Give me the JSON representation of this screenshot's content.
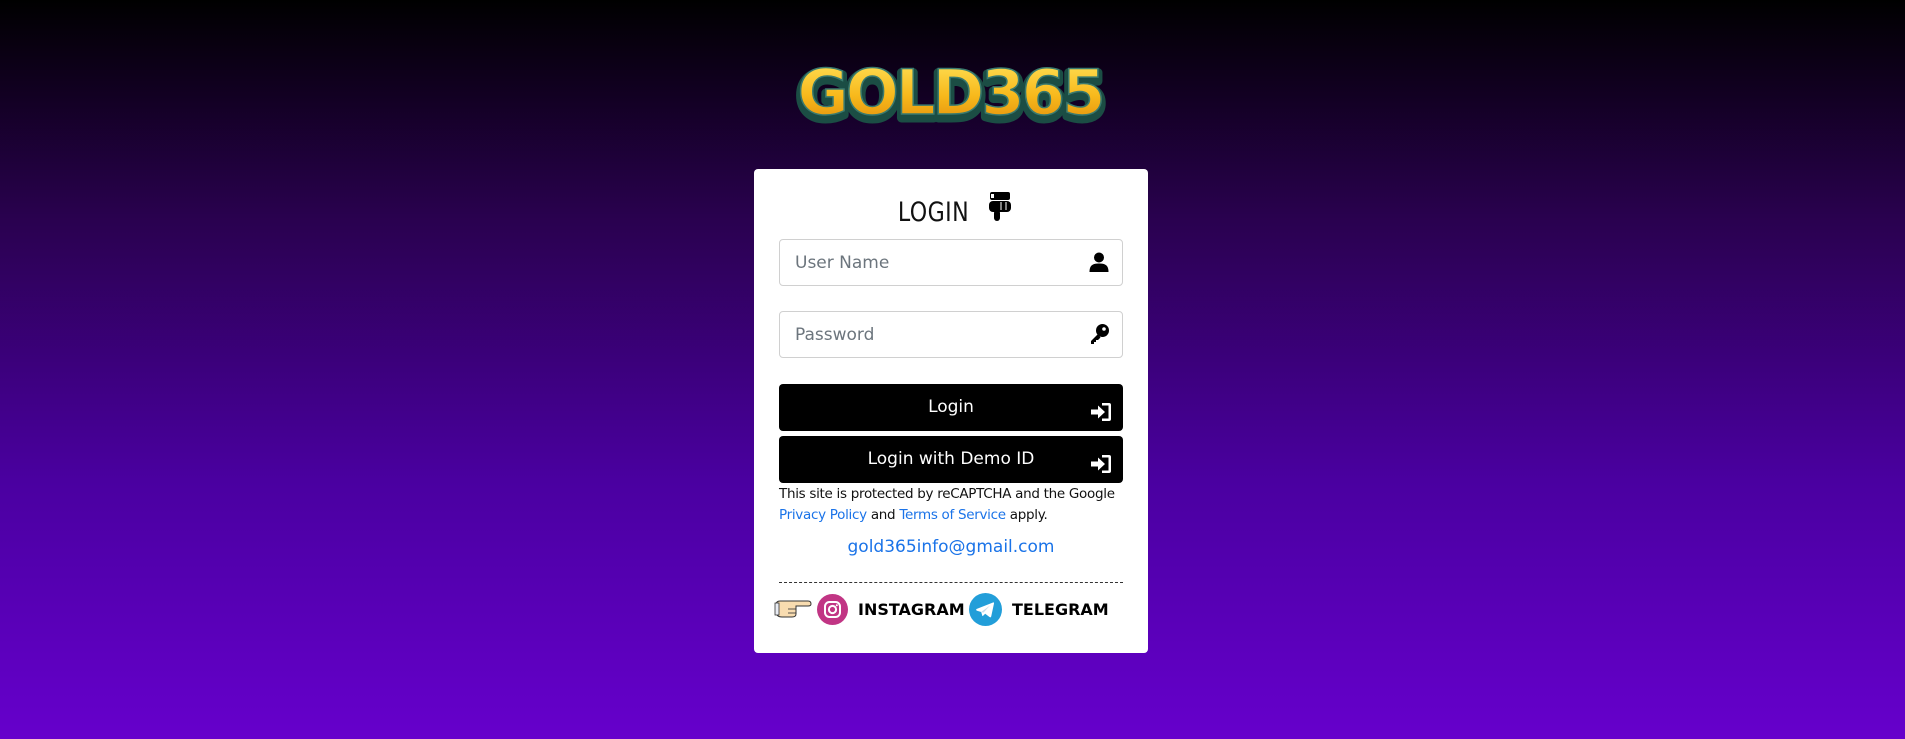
{
  "brand": {
    "logo_text": "GOLD365"
  },
  "login": {
    "title": "LOGIN",
    "username_placeholder": "User Name",
    "password_placeholder": "Password",
    "login_button": "Login",
    "demo_button": "Login with Demo ID"
  },
  "recaptcha": {
    "text_1": "This site is protected by reCAPTCHA and the Google",
    "privacy_link": "Privacy Policy",
    "and": "and",
    "terms_link": "Terms of Service",
    "apply": "apply."
  },
  "contact": {
    "email": "gold365info@gmail.com"
  },
  "social": {
    "instagram_label": "INSTAGRAM",
    "telegram_label": "TELEGRAM"
  },
  "colors": {
    "link": "#1a73e8",
    "button_bg": "#000000",
    "instagram": "#c13584",
    "telegram": "#229ed9"
  }
}
